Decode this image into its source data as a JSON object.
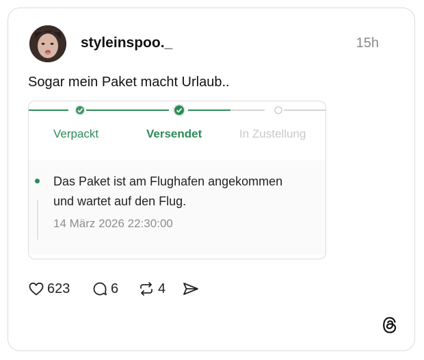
{
  "post": {
    "username": "styleinspoo._",
    "time": "15h",
    "text": "Sogar mein Paket macht Urlaub.."
  },
  "tracking": {
    "steps": [
      {
        "label": "Verpackt",
        "state": "done"
      },
      {
        "label": "Versendet",
        "state": "current"
      },
      {
        "label": "In Zustellung",
        "state": "pending"
      }
    ],
    "status_message_line1": "Das Paket ist am Flughafen angekommen",
    "status_message_line2": "und wartet auf den Flug.",
    "status_date": "14 März 2026 22:30:00",
    "accent_color": "#2e8a57"
  },
  "actions": {
    "likes": "623",
    "replies": "6",
    "reposts": "4"
  },
  "icons": [
    "heart-icon",
    "reply-icon",
    "repost-icon",
    "share-icon",
    "threads-logo-icon",
    "check-icon"
  ]
}
